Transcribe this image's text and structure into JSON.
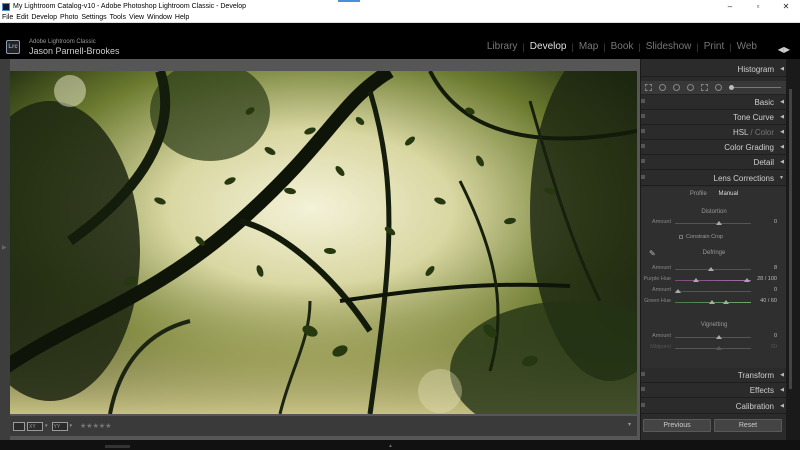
{
  "window": {
    "title": "My Lightroom Catalog-v10 - Adobe Photoshop Lightroom Classic - Develop",
    "minimize": "–",
    "maximize": "▫",
    "close": "✕"
  },
  "menu": [
    "File",
    "Edit",
    "Develop",
    "Photo",
    "Settings",
    "Tools",
    "View",
    "Window",
    "Help"
  ],
  "identity": {
    "logo": "Lrc",
    "product": "Adobe Lightroom Classic",
    "user": "Jason Parnell-Brookes"
  },
  "modules": [
    {
      "label": "Library",
      "active": false
    },
    {
      "label": "Develop",
      "active": true
    },
    {
      "label": "Map",
      "active": false
    },
    {
      "label": "Book",
      "active": false
    },
    {
      "label": "Slideshow",
      "active": false
    },
    {
      "label": "Print",
      "active": false
    },
    {
      "label": "Web",
      "active": false
    }
  ],
  "toolbar": {
    "view_loupe": "",
    "view_compare": "XY",
    "view_survey": "YY",
    "stars": "★★★★★",
    "expand": "▾"
  },
  "panels": {
    "histogram": "Histogram",
    "basic": "Basic",
    "tone_curve": "Tone Curve",
    "hsl": "HSL",
    "hsl_sep": " / ",
    "color": "Color",
    "color_grading": "Color Grading",
    "detail": "Detail",
    "lens_corrections": "Lens Corrections",
    "transform": "Transform",
    "effects": "Effects",
    "calibration": "Calibration"
  },
  "lens": {
    "tabs": [
      "Profile",
      "Manual"
    ],
    "active_tab": "Manual",
    "distortion": {
      "title": "Distortion",
      "amount_label": "Amount",
      "amount_value": "0",
      "constrain_crop": "Constrain Crop"
    },
    "defringe": {
      "title": "Defringe",
      "rows": [
        {
          "label": "Amount",
          "value": "8"
        },
        {
          "label": "Purple Hue",
          "value": "28 / 100"
        },
        {
          "label": "Amount",
          "value": "0"
        },
        {
          "label": "Green Hue",
          "value": "40 / 60"
        }
      ]
    },
    "vignetting": {
      "title": "Vignetting",
      "rows": [
        {
          "label": "Amount",
          "value": "0"
        },
        {
          "label": "Midpoint",
          "value": "50"
        }
      ]
    }
  },
  "buttons": {
    "previous": "Previous",
    "reset": "Reset"
  }
}
